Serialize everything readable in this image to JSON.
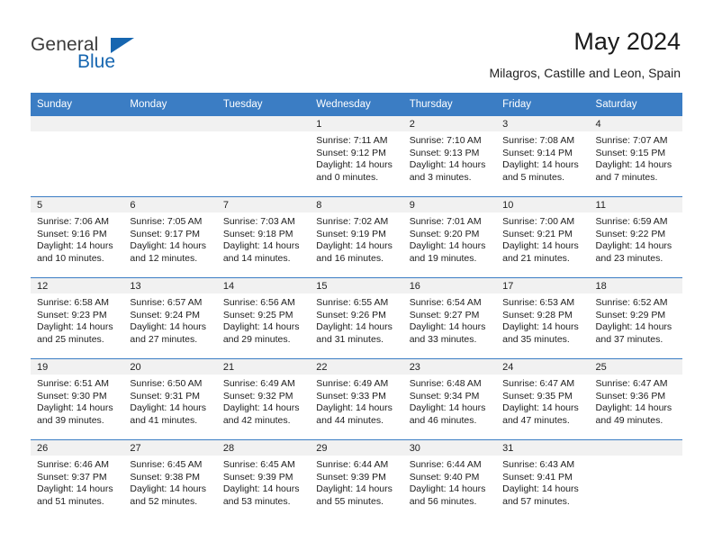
{
  "brand": {
    "name_part1": "General",
    "name_part2": "Blue",
    "accent_color": "#1666b0"
  },
  "header": {
    "title": "May 2024",
    "subtitle": "Milagros, Castille and Leon, Spain"
  },
  "calendar": {
    "header_bg": "#3b7dc4",
    "daynum_bg": "#f1f1f1",
    "weekday_headers": [
      "Sunday",
      "Monday",
      "Tuesday",
      "Wednesday",
      "Thursday",
      "Friday",
      "Saturday"
    ],
    "weeks": [
      [
        {
          "day": "",
          "sunrise": "",
          "sunset": "",
          "daylight": "",
          "empty": true
        },
        {
          "day": "",
          "sunrise": "",
          "sunset": "",
          "daylight": "",
          "empty": true
        },
        {
          "day": "",
          "sunrise": "",
          "sunset": "",
          "daylight": "",
          "empty": true
        },
        {
          "day": "1",
          "sunrise": "Sunrise: 7:11 AM",
          "sunset": "Sunset: 9:12 PM",
          "daylight": "Daylight: 14 hours and 0 minutes."
        },
        {
          "day": "2",
          "sunrise": "Sunrise: 7:10 AM",
          "sunset": "Sunset: 9:13 PM",
          "daylight": "Daylight: 14 hours and 3 minutes."
        },
        {
          "day": "3",
          "sunrise": "Sunrise: 7:08 AM",
          "sunset": "Sunset: 9:14 PM",
          "daylight": "Daylight: 14 hours and 5 minutes."
        },
        {
          "day": "4",
          "sunrise": "Sunrise: 7:07 AM",
          "sunset": "Sunset: 9:15 PM",
          "daylight": "Daylight: 14 hours and 7 minutes."
        }
      ],
      [
        {
          "day": "5",
          "sunrise": "Sunrise: 7:06 AM",
          "sunset": "Sunset: 9:16 PM",
          "daylight": "Daylight: 14 hours and 10 minutes."
        },
        {
          "day": "6",
          "sunrise": "Sunrise: 7:05 AM",
          "sunset": "Sunset: 9:17 PM",
          "daylight": "Daylight: 14 hours and 12 minutes."
        },
        {
          "day": "7",
          "sunrise": "Sunrise: 7:03 AM",
          "sunset": "Sunset: 9:18 PM",
          "daylight": "Daylight: 14 hours and 14 minutes."
        },
        {
          "day": "8",
          "sunrise": "Sunrise: 7:02 AM",
          "sunset": "Sunset: 9:19 PM",
          "daylight": "Daylight: 14 hours and 16 minutes."
        },
        {
          "day": "9",
          "sunrise": "Sunrise: 7:01 AM",
          "sunset": "Sunset: 9:20 PM",
          "daylight": "Daylight: 14 hours and 19 minutes."
        },
        {
          "day": "10",
          "sunrise": "Sunrise: 7:00 AM",
          "sunset": "Sunset: 9:21 PM",
          "daylight": "Daylight: 14 hours and 21 minutes."
        },
        {
          "day": "11",
          "sunrise": "Sunrise: 6:59 AM",
          "sunset": "Sunset: 9:22 PM",
          "daylight": "Daylight: 14 hours and 23 minutes."
        }
      ],
      [
        {
          "day": "12",
          "sunrise": "Sunrise: 6:58 AM",
          "sunset": "Sunset: 9:23 PM",
          "daylight": "Daylight: 14 hours and 25 minutes."
        },
        {
          "day": "13",
          "sunrise": "Sunrise: 6:57 AM",
          "sunset": "Sunset: 9:24 PM",
          "daylight": "Daylight: 14 hours and 27 minutes."
        },
        {
          "day": "14",
          "sunrise": "Sunrise: 6:56 AM",
          "sunset": "Sunset: 9:25 PM",
          "daylight": "Daylight: 14 hours and 29 minutes."
        },
        {
          "day": "15",
          "sunrise": "Sunrise: 6:55 AM",
          "sunset": "Sunset: 9:26 PM",
          "daylight": "Daylight: 14 hours and 31 minutes."
        },
        {
          "day": "16",
          "sunrise": "Sunrise: 6:54 AM",
          "sunset": "Sunset: 9:27 PM",
          "daylight": "Daylight: 14 hours and 33 minutes."
        },
        {
          "day": "17",
          "sunrise": "Sunrise: 6:53 AM",
          "sunset": "Sunset: 9:28 PM",
          "daylight": "Daylight: 14 hours and 35 minutes."
        },
        {
          "day": "18",
          "sunrise": "Sunrise: 6:52 AM",
          "sunset": "Sunset: 9:29 PM",
          "daylight": "Daylight: 14 hours and 37 minutes."
        }
      ],
      [
        {
          "day": "19",
          "sunrise": "Sunrise: 6:51 AM",
          "sunset": "Sunset: 9:30 PM",
          "daylight": "Daylight: 14 hours and 39 minutes."
        },
        {
          "day": "20",
          "sunrise": "Sunrise: 6:50 AM",
          "sunset": "Sunset: 9:31 PM",
          "daylight": "Daylight: 14 hours and 41 minutes."
        },
        {
          "day": "21",
          "sunrise": "Sunrise: 6:49 AM",
          "sunset": "Sunset: 9:32 PM",
          "daylight": "Daylight: 14 hours and 42 minutes."
        },
        {
          "day": "22",
          "sunrise": "Sunrise: 6:49 AM",
          "sunset": "Sunset: 9:33 PM",
          "daylight": "Daylight: 14 hours and 44 minutes."
        },
        {
          "day": "23",
          "sunrise": "Sunrise: 6:48 AM",
          "sunset": "Sunset: 9:34 PM",
          "daylight": "Daylight: 14 hours and 46 minutes."
        },
        {
          "day": "24",
          "sunrise": "Sunrise: 6:47 AM",
          "sunset": "Sunset: 9:35 PM",
          "daylight": "Daylight: 14 hours and 47 minutes."
        },
        {
          "day": "25",
          "sunrise": "Sunrise: 6:47 AM",
          "sunset": "Sunset: 9:36 PM",
          "daylight": "Daylight: 14 hours and 49 minutes."
        }
      ],
      [
        {
          "day": "26",
          "sunrise": "Sunrise: 6:46 AM",
          "sunset": "Sunset: 9:37 PM",
          "daylight": "Daylight: 14 hours and 51 minutes."
        },
        {
          "day": "27",
          "sunrise": "Sunrise: 6:45 AM",
          "sunset": "Sunset: 9:38 PM",
          "daylight": "Daylight: 14 hours and 52 minutes."
        },
        {
          "day": "28",
          "sunrise": "Sunrise: 6:45 AM",
          "sunset": "Sunset: 9:39 PM",
          "daylight": "Daylight: 14 hours and 53 minutes."
        },
        {
          "day": "29",
          "sunrise": "Sunrise: 6:44 AM",
          "sunset": "Sunset: 9:39 PM",
          "daylight": "Daylight: 14 hours and 55 minutes."
        },
        {
          "day": "30",
          "sunrise": "Sunrise: 6:44 AM",
          "sunset": "Sunset: 9:40 PM",
          "daylight": "Daylight: 14 hours and 56 minutes."
        },
        {
          "day": "31",
          "sunrise": "Sunrise: 6:43 AM",
          "sunset": "Sunset: 9:41 PM",
          "daylight": "Daylight: 14 hours and 57 minutes."
        },
        {
          "day": "",
          "sunrise": "",
          "sunset": "",
          "daylight": "",
          "empty": true
        }
      ]
    ]
  }
}
